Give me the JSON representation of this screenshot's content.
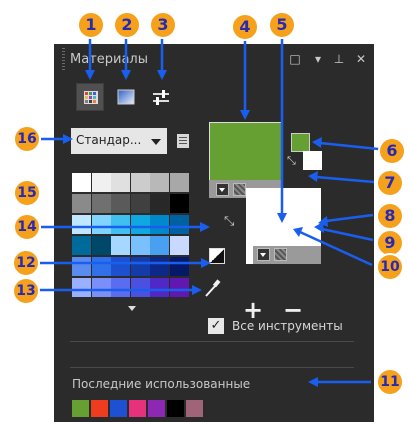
{
  "panel": {
    "title": "Материалы",
    "window_buttons": [
      "□",
      "▾",
      "⊥",
      "✕"
    ],
    "palette_combo": "Стандар...",
    "checkbox": {
      "checked": true,
      "label": "Все инструменты"
    },
    "recent_label": "Последние использованные"
  },
  "colors": {
    "foreground": "#66a032",
    "background": "#ffffff",
    "recent": [
      "#66a032",
      "#f03c1e",
      "#1e50d2",
      "#e6327d",
      "#8c28b4",
      "#000000",
      "#a06478"
    ],
    "swatches": [
      [
        "#ffffff",
        "#f0f0f0",
        "#e0e0e0",
        "#cccccc",
        "#b8b8b8",
        "#a8a8a8"
      ],
      [
        "#8a8a8a",
        "#707070",
        "#5a5a5a",
        "#404040",
        "#282828",
        "#000000"
      ],
      [
        "#bfe8ff",
        "#80d4ff",
        "#40c0f0",
        "#10a8e0",
        "#0088cc",
        "#0060a0"
      ],
      [
        "#006a9a",
        "#00486a",
        "#a6d8ff",
        "#78c0ff",
        "#4aa0f0",
        "#c8d8ff"
      ],
      [
        "#5a8cf0",
        "#3070e8",
        "#1c50d0",
        "#143ca8",
        "#0c2888",
        "#061868"
      ],
      [
        "#9ab0ff",
        "#7a90f8",
        "#5a6cf0",
        "#4a50e0",
        "#5028c8",
        "#6018b0"
      ]
    ]
  },
  "icons": {
    "tool_swatch": "swatch-grid-icon",
    "tool_gradient": "gradient-icon",
    "tool_sliders": "sliders-icon",
    "palette_menu": "palette-menu-icon",
    "eyedropper": "eyedropper-icon",
    "add": "+",
    "remove": "−"
  },
  "callouts": [
    "1",
    "2",
    "3",
    "4",
    "5",
    "6",
    "7",
    "8",
    "9",
    "10",
    "11",
    "12",
    "13",
    "14",
    "15",
    "16"
  ],
  "accent": "#f5a11c"
}
